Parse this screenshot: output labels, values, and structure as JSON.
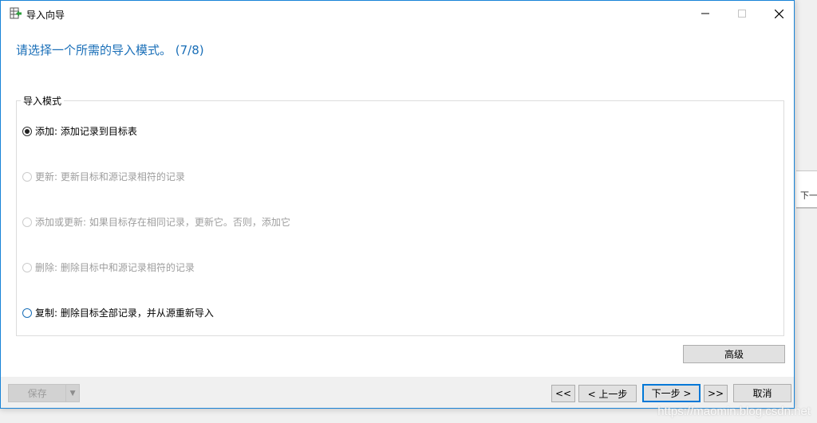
{
  "window": {
    "title": "导入向导",
    "icon": "import-wizard-icon",
    "controls": {
      "minimize": "minimize-icon",
      "maximize": "maximize-icon",
      "close": "close-icon"
    }
  },
  "header": {
    "title": "请选择一个所需的导入模式。 (7/8)"
  },
  "import_mode": {
    "legend": "导入模式",
    "options": [
      {
        "label": "添加: 添加记录到目标表",
        "checked": true,
        "enabled": true
      },
      {
        "label": "更新: 更新目标和源记录相符的记录",
        "checked": false,
        "enabled": false
      },
      {
        "label": "添加或更新: 如果目标存在相同记录，更新它。否则，添加它",
        "checked": false,
        "enabled": false
      },
      {
        "label": "删除: 删除目标中和源记录相符的记录",
        "checked": false,
        "enabled": false
      },
      {
        "label": "复制: 删除目标全部记录，并从源重新导入",
        "checked": false,
        "enabled": true
      }
    ]
  },
  "buttons": {
    "advanced": "高级",
    "save": "保存",
    "first": "<<",
    "prev": "< 上一步",
    "next": "下一步 >",
    "last": ">>",
    "cancel": "取消"
  },
  "background": {
    "right_fragment": "下一步",
    "watermark": "https://maomin.blog.csdn.net"
  },
  "colors": {
    "accent": "#1a6fb8",
    "window_border": "#1883d7",
    "focus_border": "#0078d7"
  }
}
